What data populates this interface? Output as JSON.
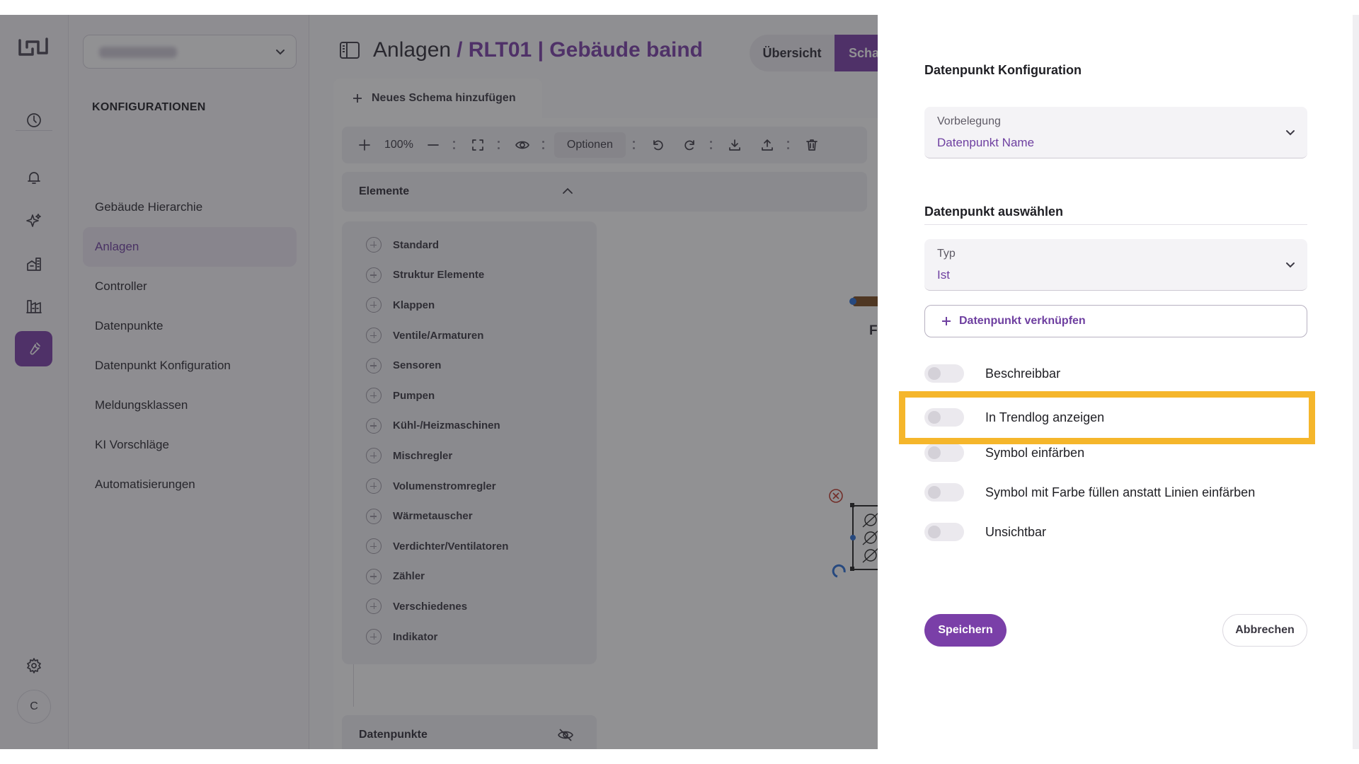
{
  "sidebar": {
    "heading": "KONFIGURATIONEN",
    "items": [
      {
        "label": "Gebäude Hierarchie",
        "active": false
      },
      {
        "label": "Anlagen",
        "active": true
      },
      {
        "label": "Controller",
        "active": false
      },
      {
        "label": "Datenpunkte",
        "active": false
      },
      {
        "label": "Datenpunkt Konfiguration",
        "active": false
      },
      {
        "label": "Meldungsklassen",
        "active": false
      },
      {
        "label": "KI Vorschläge",
        "active": false
      },
      {
        "label": "Automatisierungen",
        "active": false
      }
    ]
  },
  "rail": {
    "icons": [
      "dashboard-icon",
      "bell-icon",
      "sparkle-icon",
      "buildings-icon",
      "factory-icon",
      "wrench-icon",
      "gear-icon"
    ],
    "avatar_initial": "C",
    "accent": "#7a3fa8"
  },
  "header": {
    "title_prefix": "Anlagen",
    "title_current": "/ RLT01 | Gebäude baind",
    "tab_overview": "Übersicht",
    "tab_schema": "Scha"
  },
  "schema": {
    "add_tab_label": "Neues Schema hinzufügen",
    "zoom": "100%",
    "options_label": "Optionen",
    "elements_heading": "Elemente",
    "elements": [
      "Standard",
      "Struktur Elemente",
      "Klappen",
      "Ventile/Armaturen",
      "Sensoren",
      "Pumpen",
      "Kühl-/Heizmaschinen",
      "Mischregler",
      "Volumenstromregler",
      "Wärmetauscher",
      "Verdichter/Ventilatoren",
      "Zähler",
      "Verschiedenes",
      "Indikator"
    ],
    "datapoints_heading": "Datenpunkte",
    "canvas_label": "Fortlu"
  },
  "drawer": {
    "title": "Datenpunkt Konfiguration",
    "preset": {
      "label": "Vorbelegung",
      "value": "Datenpunkt Name"
    },
    "select_heading": "Datenpunkt auswählen",
    "type": {
      "label": "Typ",
      "value": "Ist"
    },
    "link_button": "Datenpunkt verknüpfen",
    "toggles": [
      {
        "label": "Beschreibbar",
        "on": false
      },
      {
        "label": "In Trendlog anzeigen",
        "on": false
      },
      {
        "label": "Symbol einfärben",
        "on": false
      },
      {
        "label": "Symbol mit Farbe füllen anstatt Linien einfärben",
        "on": false
      },
      {
        "label": "Unsichtbar",
        "on": false
      }
    ],
    "save_label": "Speichern",
    "cancel_label": "Abbrechen",
    "highlight_color": "#f5b62b"
  }
}
